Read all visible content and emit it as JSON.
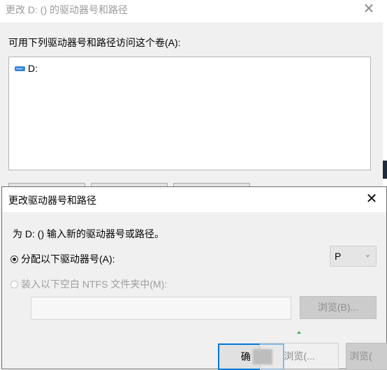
{
  "back_dialog": {
    "title": "更改 D: () 的驱动器号和路径",
    "prompt": "可用下列驱动器号和路径访问这个卷(A):",
    "items": [
      {
        "label": "D:"
      }
    ]
  },
  "front_dialog": {
    "title": "更改驱动器号和路径",
    "prompt": "为 D: () 输入新的驱动器号或路径。",
    "option_assign_label": "分配以下驱动器号(A):",
    "option_mount_label": "装入以下空白 NTFS 文件夹中(M):",
    "drive_letter_value": "P",
    "path_value": "",
    "browse_label": "浏览(B)...",
    "ok_label": "确",
    "ghost_browse_label": "浏览(...",
    "right_browse_label": "浏览("
  },
  "icons": {
    "back_close": "close-icon",
    "front_close": "close-icon",
    "drive": "drive-icon",
    "chevron": "chevron-down-icon"
  },
  "colors": {
    "accent": "#0078d7",
    "title_gray": "#9b9b9b",
    "dialog_bg": "#f0f0f0"
  }
}
